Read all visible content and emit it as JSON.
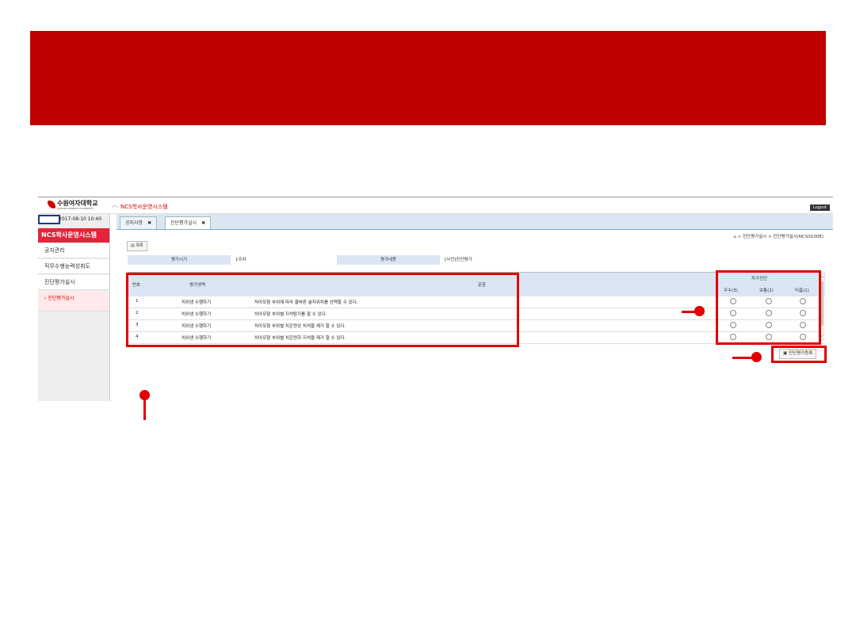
{
  "app": {
    "logo_text": "수원여자대학교",
    "logo_sub": "SUWON WOMEN'S UNIVERSITY",
    "system_title": "NCS학사운영시스템",
    "logout_label": "Logout",
    "datetime": "2017-08-10 10:40"
  },
  "sidebar": {
    "header": "NCS학사운영시스템",
    "items": [
      {
        "label": "공지관리"
      },
      {
        "label": "직무수행능력성취도"
      },
      {
        "label": "진단평가실시"
      },
      {
        "label": "진단평가실시"
      }
    ]
  },
  "tabs": [
    {
      "label": "공지사항",
      "close": "✖"
    },
    {
      "label": "진단평가실시",
      "close": "✖"
    }
  ],
  "breadcrumb": "⌂ > 진단평가실시 > 진단평가실시(NCS0100E)",
  "toolbar": {
    "list_label": "목록"
  },
  "info": {
    "period_label": "평가시기",
    "period_value": "1주차",
    "content_label": "평가내용",
    "content_value": "[사전]진단평가"
  },
  "grid": {
    "headers": {
      "no": "번호",
      "area": "평가영역",
      "question": "문항",
      "self": "자가진단",
      "good": "우수(3)",
      "normal": "보통(2)",
      "poor": "미흡(1)"
    },
    "rows": [
      {
        "no": "1",
        "area": "치위생 수행하기",
        "question": "치아모형 부위에 따라 올바른 술자위치를 선택할 수 있다."
      },
      {
        "no": "2",
        "area": "치위생 수행하기",
        "question": "치아모형 부위별 지석탐지를 할 수 있다."
      },
      {
        "no": "3",
        "area": "치위생 수행하기",
        "question": "치아모형 부위별 치은연상 치석을 제거 할 수 있다."
      },
      {
        "no": "4",
        "area": "치위생 수행하기",
        "question": "치아모형 부위별 치은연하 지석을 제거 할 수 있다."
      }
    ]
  },
  "submit_label": "진단평가등록",
  "colors": {
    "banner": "#c00000",
    "highlight": "#e00000",
    "sidebar_header": "#e3243a"
  }
}
